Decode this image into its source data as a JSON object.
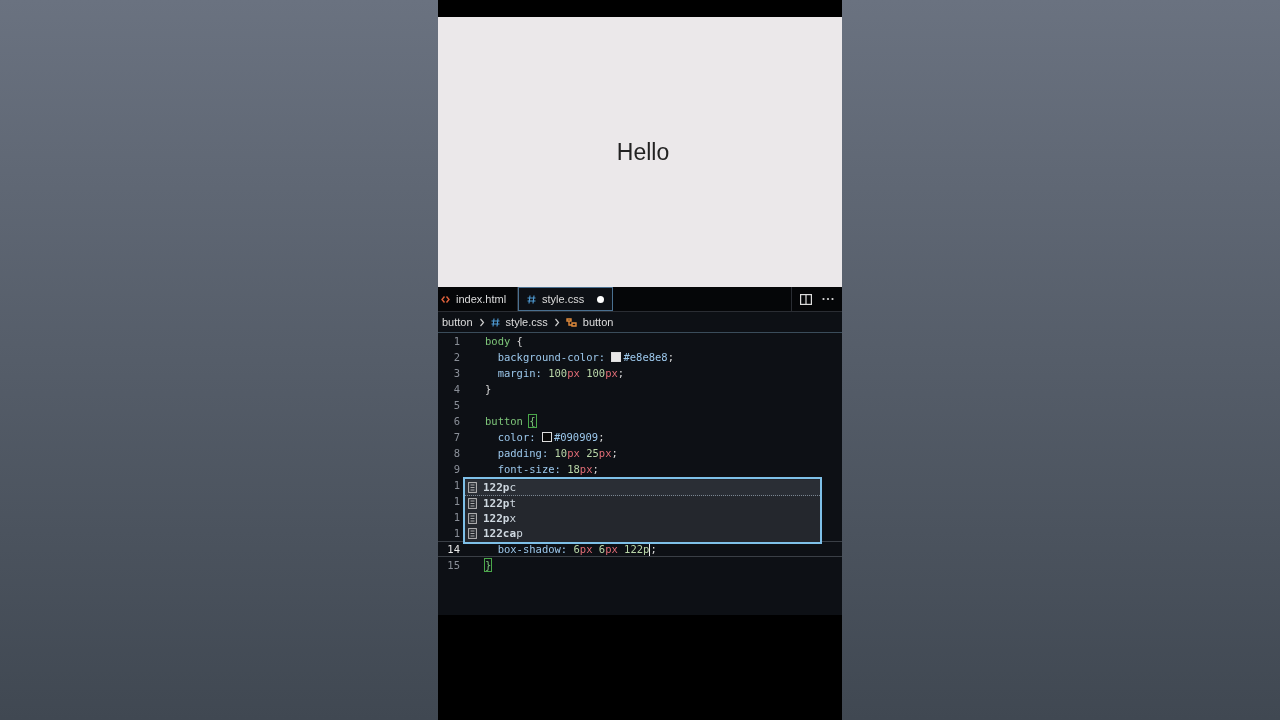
{
  "preview": {
    "text": "Hello"
  },
  "tabs": [
    {
      "label": "index.html",
      "selected": false
    },
    {
      "label": "style.css",
      "selected": true,
      "modified": true
    }
  ],
  "breadcrumb": [
    {
      "label": "button"
    },
    {
      "label": "style.css"
    },
    {
      "label": "button"
    }
  ],
  "lines": [
    {
      "number": "1",
      "current": false,
      "tokens": [
        {
          "text": "body ",
          "kind": "selector"
        },
        {
          "text": "{",
          "kind": "punct"
        }
      ]
    },
    {
      "number": "2",
      "current": false,
      "tokens": [
        {
          "text": "  background-color: ",
          "kind": "prop"
        },
        {
          "kind": "swatch",
          "color": "#e8e8e8"
        },
        {
          "text": "#e8e8e8",
          "kind": "prop"
        },
        {
          "text": ";",
          "kind": "punct"
        }
      ]
    },
    {
      "number": "3",
      "current": false,
      "tokens": [
        {
          "text": "  margin: ",
          "kind": "prop"
        },
        {
          "text": "100",
          "kind": "num"
        },
        {
          "text": "px ",
          "kind": "unit"
        },
        {
          "text": "100",
          "kind": "num"
        },
        {
          "text": "px",
          "kind": "unit"
        },
        {
          "text": ";",
          "kind": "punct"
        }
      ]
    },
    {
      "number": "4",
      "current": false,
      "tokens": [
        {
          "text": "}",
          "kind": "punct"
        }
      ]
    },
    {
      "number": "5",
      "current": false
    },
    {
      "number": "6",
      "current": false,
      "tokens": [
        {
          "text": "button ",
          "kind": "selector"
        },
        {
          "text": "{",
          "kind": "bracket"
        }
      ]
    },
    {
      "number": "7",
      "current": false,
      "tokens": [
        {
          "text": "  color: ",
          "kind": "prop"
        },
        {
          "kind": "swatch",
          "color": "#090909"
        },
        {
          "text": "#090909",
          "kind": "prop"
        },
        {
          "text": ";",
          "kind": "punct"
        }
      ]
    },
    {
      "number": "8",
      "current": false,
      "tokens": [
        {
          "text": "  padding: ",
          "kind": "prop"
        },
        {
          "text": "10",
          "kind": "num"
        },
        {
          "text": "px ",
          "kind": "unit"
        },
        {
          "text": "25",
          "kind": "num"
        },
        {
          "text": "px",
          "kind": "unit"
        },
        {
          "text": ";",
          "kind": "punct"
        }
      ]
    },
    {
      "number": "9",
      "current": false,
      "tokens": [
        {
          "text": "  font-size: ",
          "kind": "prop"
        },
        {
          "text": "18",
          "kind": "num"
        },
        {
          "text": "px",
          "kind": "unit"
        },
        {
          "text": ";",
          "kind": "punct"
        }
      ]
    },
    {
      "number": "1",
      "current": false
    },
    {
      "number": "1",
      "current": false
    },
    {
      "number": "1",
      "current": false
    },
    {
      "number": "1",
      "current": false
    },
    {
      "number": "14",
      "current": true,
      "tokens": [
        {
          "text": "  box-shadow: ",
          "kind": "prop"
        },
        {
          "text": "6",
          "kind": "num"
        },
        {
          "text": "px ",
          "kind": "unit"
        },
        {
          "text": "6",
          "kind": "num"
        },
        {
          "text": "px ",
          "kind": "unit"
        },
        {
          "text": "122p",
          "kind": "num"
        },
        {
          "kind": "cursor"
        },
        {
          "text": ";",
          "kind": "punct"
        }
      ]
    },
    {
      "number": "15",
      "current": false,
      "tokens": [
        {
          "text": "}",
          "kind": "bracket"
        }
      ]
    }
  ],
  "suggestions": [
    {
      "label": "**122p**c",
      "selected": true
    },
    {
      "label": "**122p**t",
      "selected": false
    },
    {
      "label": "**122p**x",
      "selected": false
    },
    {
      "label": "**122ca**p",
      "selected": false
    }
  ]
}
